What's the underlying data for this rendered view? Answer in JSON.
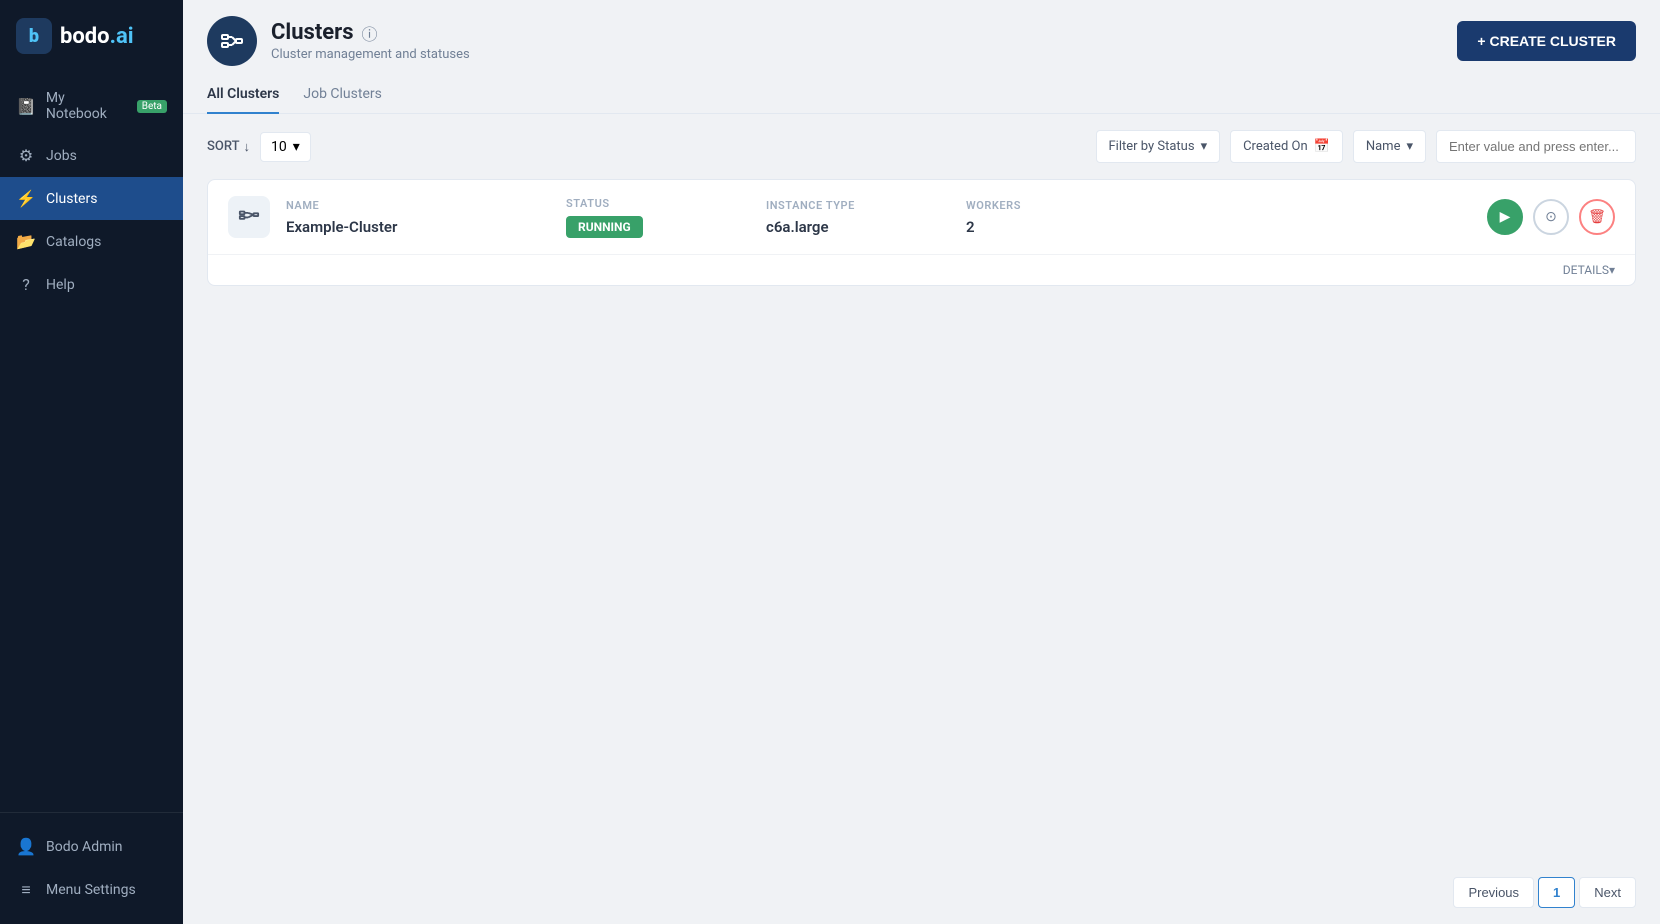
{
  "sidebar": {
    "logo": "bodo.ai",
    "logo_icon": "☰",
    "nav_items": [
      {
        "id": "my-notebook",
        "label": "My Notebook",
        "icon": "📓",
        "badge": "Beta",
        "active": false
      },
      {
        "id": "jobs",
        "label": "Jobs",
        "icon": "⚙",
        "active": false
      },
      {
        "id": "clusters",
        "label": "Clusters",
        "icon": "⚡",
        "active": true
      },
      {
        "id": "catalogs",
        "label": "Catalogs",
        "icon": "📂",
        "active": false
      },
      {
        "id": "help",
        "label": "Help",
        "icon": "?",
        "active": false
      }
    ],
    "bottom_items": [
      {
        "id": "bodo-admin",
        "label": "Bodo Admin",
        "icon": "👤"
      },
      {
        "id": "menu-settings",
        "label": "Menu Settings",
        "icon": "≡"
      }
    ]
  },
  "header": {
    "title": "Clusters",
    "subtitle": "Cluster management and statuses",
    "create_button": "+ CREATE CLUSTER"
  },
  "tabs": [
    {
      "id": "all-clusters",
      "label": "All Clusters",
      "active": true
    },
    {
      "id": "job-clusters",
      "label": "Job Clusters",
      "active": false
    }
  ],
  "toolbar": {
    "sort_label": "SORT",
    "per_page_value": "10",
    "filter_status_label": "Filter by Status",
    "date_filter_label": "Created On",
    "name_filter_label": "Name",
    "search_placeholder": "Enter value and press enter..."
  },
  "clusters": [
    {
      "id": "example-cluster",
      "name": "Example-Cluster",
      "status": "RUNNING",
      "instance_type": "c6a.large",
      "workers": "2"
    }
  ],
  "table_headers": {
    "name": "NAME",
    "status": "STATUS",
    "instance_type": "INSTANCE TYPE",
    "workers": "WORKERS"
  },
  "details_label": "DETAILS",
  "pagination": {
    "previous_label": "Previous",
    "next_label": "Next",
    "current_page": "1"
  }
}
